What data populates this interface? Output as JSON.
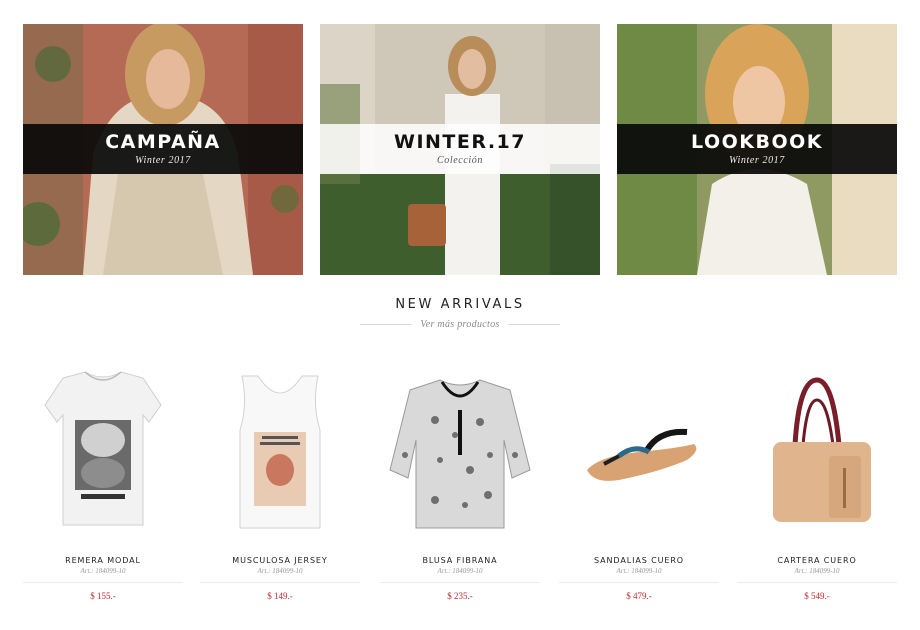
{
  "banners": [
    {
      "title": "CAMPAÑA",
      "subtitle": "Winter 2017"
    },
    {
      "title": "WINTER.17",
      "subtitle": "Colección"
    },
    {
      "title": "LOOKBOOK",
      "subtitle": "Winter 2017"
    }
  ],
  "section": {
    "title": "NEW ARRIVALS",
    "more_link": "Ver más productos"
  },
  "products": [
    {
      "name": "REMERA MODAL",
      "code": "Art.: 184099-10",
      "price": "$ 155.-",
      "image": "tiger-print-tshirt"
    },
    {
      "name": "MUSCULOSA JERSEY",
      "code": "Art.: 184099-10",
      "price": "$ 149.-",
      "image": "printed-tank-top"
    },
    {
      "name": "BLUSA FIBRANA",
      "code": "Art.: 184099-10",
      "price": "$ 235.-",
      "image": "paisley-blouse"
    },
    {
      "name": "SANDALIAS CUERO",
      "code": "Art.: 184099-10",
      "price": "$ 479.-",
      "image": "leather-sandal"
    },
    {
      "name": "CARTERA CUERO",
      "code": "Art.: 184099-10",
      "price": "$ 549.-",
      "image": "leather-handbag"
    }
  ],
  "colors": {
    "price": "#c0282d",
    "band_dark": "#0a0a0a",
    "band_light": "#ffffff"
  }
}
